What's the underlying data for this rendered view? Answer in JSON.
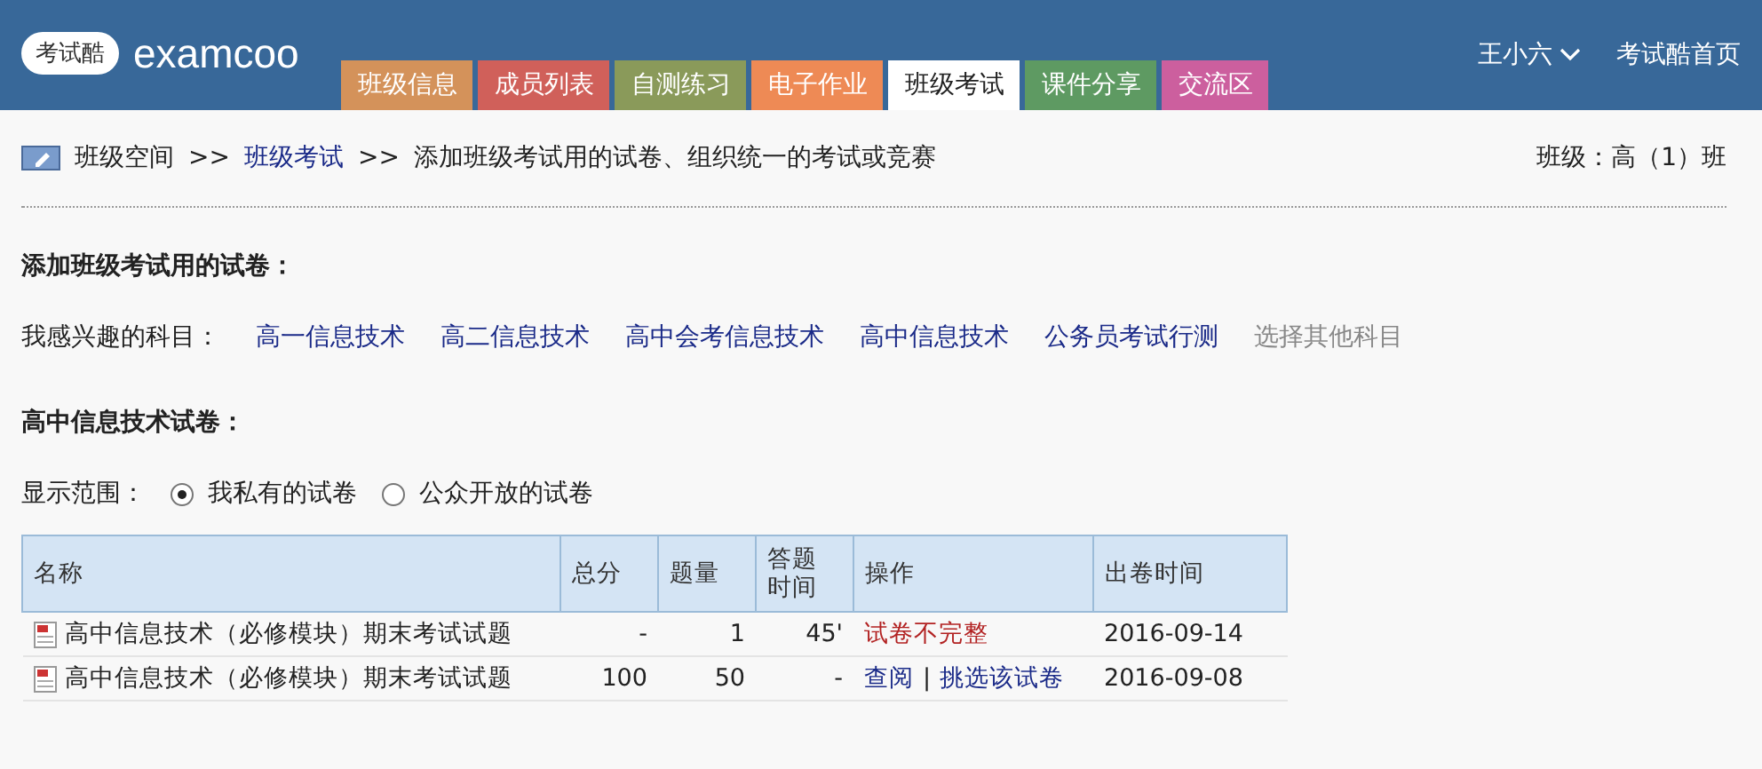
{
  "header": {
    "logo_text": "考试酷",
    "brand": "examcoo",
    "tabs": [
      {
        "label": "班级信息",
        "color": "#d4925a",
        "selected": false
      },
      {
        "label": "成员列表",
        "color": "#d0605a",
        "selected": false
      },
      {
        "label": "自测练习",
        "color": "#8a9a5a",
        "selected": false
      },
      {
        "label": "电子作业",
        "color": "#ee8a55",
        "selected": false
      },
      {
        "label": "班级考试",
        "color": "#ffffff",
        "selected": true
      },
      {
        "label": "课件分享",
        "color": "#5e9a62",
        "selected": false
      },
      {
        "label": "交流区",
        "color": "#cc5f9e",
        "selected": false
      }
    ],
    "user": "王小六",
    "home_link": "考试酷首页"
  },
  "breadcrumb": {
    "items": [
      {
        "label": "班级空间",
        "kind": "text"
      },
      {
        "label": ">>",
        "kind": "sep"
      },
      {
        "label": "班级考试",
        "kind": "link"
      },
      {
        "label": ">>",
        "kind": "sep"
      },
      {
        "label": "添加班级考试用的试卷、组织统一的考试或竞赛",
        "kind": "text"
      }
    ],
    "class_info": "班级：高（1）班"
  },
  "section_title": "添加班级考试用的试卷：",
  "subjects": {
    "label": "我感兴趣的科目：",
    "items": [
      {
        "label": "高一信息技术",
        "kind": "link"
      },
      {
        "label": "高二信息技术",
        "kind": "link"
      },
      {
        "label": "高中会考信息技术",
        "kind": "link"
      },
      {
        "label": "高中信息技术",
        "kind": "link"
      },
      {
        "label": "公务员考试行测",
        "kind": "link"
      },
      {
        "label": "选择其他科目",
        "kind": "muted"
      }
    ]
  },
  "papers_title": "高中信息技术试卷：",
  "scope": {
    "label": "显示范围：",
    "options": [
      {
        "label": "我私有的试卷",
        "selected": true
      },
      {
        "label": "公众开放的试卷",
        "selected": false
      }
    ]
  },
  "table": {
    "columns": [
      "名称",
      "总分",
      "题量",
      "答题时间",
      "操作",
      "出卷时间"
    ],
    "rows": [
      {
        "name": "高中信息技术（必修模块）期末考试试题",
        "score": "-",
        "count": "1",
        "time": "45'",
        "operation": {
          "kind": "status",
          "text": "试卷不完整"
        },
        "date": "2016-09-14"
      },
      {
        "name": "高中信息技术（必修模块）期末考试试题",
        "score": "100",
        "count": "50",
        "time": "-",
        "operation": {
          "kind": "links",
          "links": [
            "查阅",
            "挑选该试卷"
          ],
          "separator": "|"
        },
        "date": "2016-09-08"
      }
    ]
  }
}
